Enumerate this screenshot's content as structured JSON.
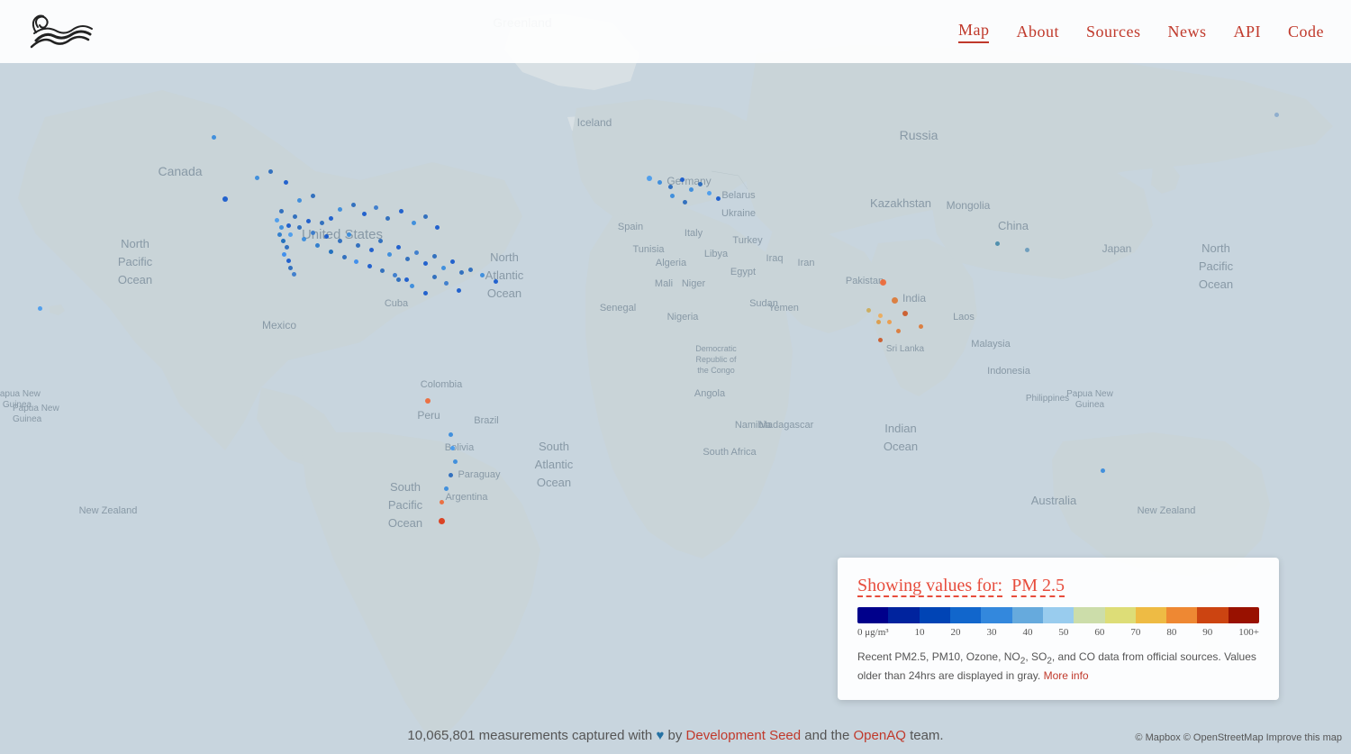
{
  "header": {
    "logo_alt": "Wind/Air quality logo",
    "nav": [
      {
        "label": "Map",
        "active": true
      },
      {
        "label": "About",
        "active": false
      },
      {
        "label": "Sources",
        "active": false
      },
      {
        "label": "News",
        "active": false
      },
      {
        "label": "API",
        "active": false
      },
      {
        "label": "Code",
        "active": false
      }
    ]
  },
  "legend": {
    "title_prefix": "Showing values for:",
    "pollutant": "PM 2.5",
    "color_stops": [
      {
        "color": "#00008b",
        "label": "0 μg/m³"
      },
      {
        "color": "#003399",
        "label": ""
      },
      {
        "color": "#0055cc",
        "label": "10"
      },
      {
        "color": "#3388dd",
        "label": "20"
      },
      {
        "color": "#55aaee",
        "label": "30"
      },
      {
        "color": "#88ccee",
        "label": "40"
      },
      {
        "color": "#aaddee",
        "label": "50"
      },
      {
        "color": "#ddeeaa",
        "label": "60"
      },
      {
        "color": "#eedd88",
        "label": "70"
      },
      {
        "color": "#eeaa55",
        "label": "80"
      },
      {
        "color": "#ee7733",
        "label": "90"
      },
      {
        "color": "#cc3311",
        "label": "100+"
      },
      {
        "color": "#880011",
        "label": ""
      }
    ],
    "description": "Recent PM2.5, PM10, Ozone, NO₂, SO₂, and CO data from official sources. Values older than 24hrs are displayed in gray.",
    "more_info_text": "More info",
    "more_info_link": "#"
  },
  "footer": {
    "measurement_count": "10,065,801",
    "text1": "measurements captured with",
    "heart": "♥",
    "text2": "by",
    "dev_seed_text": "Development Seed",
    "dev_seed_link": "#",
    "text3": "and the",
    "openaq_text": "OpenAQ",
    "openaq_link": "#",
    "text4": "team."
  },
  "map_credit": "© Mapbox © OpenStreetMap Improve this map"
}
